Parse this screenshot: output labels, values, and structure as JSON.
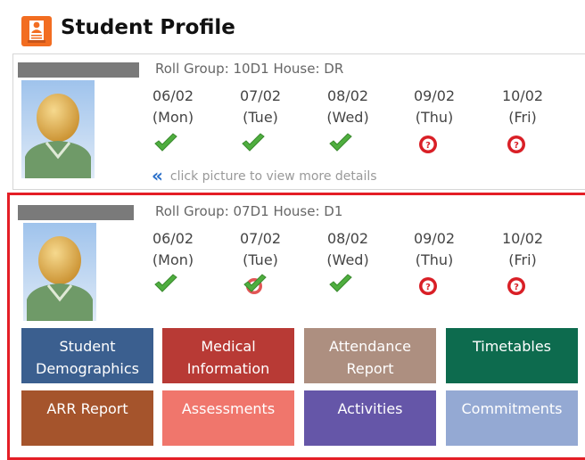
{
  "page": {
    "title": "Student Profile"
  },
  "students": [
    {
      "roll_label": "Roll Group: 10D1  House: DR",
      "days": [
        {
          "date": "06/02",
          "weekday": "(Mon)",
          "status": "present"
        },
        {
          "date": "07/02",
          "weekday": "(Tue)",
          "status": "present"
        },
        {
          "date": "08/02",
          "weekday": "(Wed)",
          "status": "present"
        },
        {
          "date": "09/02",
          "weekday": "(Thu)",
          "status": "unknown"
        },
        {
          "date": "10/02",
          "weekday": "(Fri)",
          "status": "unknown"
        }
      ],
      "hint": "click picture to view more details"
    },
    {
      "roll_label": "Roll Group: 07D1  House: D1",
      "days": [
        {
          "date": "06/02",
          "weekday": "(Mon)",
          "status": "present"
        },
        {
          "date": "07/02",
          "weekday": "(Tue)",
          "status": "present-partial"
        },
        {
          "date": "08/02",
          "weekday": "(Wed)",
          "status": "present"
        },
        {
          "date": "09/02",
          "weekday": "(Thu)",
          "status": "unknown"
        },
        {
          "date": "10/02",
          "weekday": "(Fri)",
          "status": "unknown"
        }
      ]
    }
  ],
  "tiles": [
    {
      "line1": "Student",
      "line2": "Demographics",
      "color": "#3b5f8f"
    },
    {
      "line1": "Medical",
      "line2": "Information",
      "color": "#b83a35"
    },
    {
      "line1": "Attendance",
      "line2": "Report",
      "color": "#ad8f80"
    },
    {
      "line1": "Timetables",
      "line2": "",
      "color": "#0d6b4e"
    },
    {
      "line1": "ARR Report",
      "line2": "",
      "color": "#a5542c"
    },
    {
      "line1": "Assessments",
      "line2": "",
      "color": "#f0766c"
    },
    {
      "line1": "Activities",
      "line2": "",
      "color": "#6556a8"
    },
    {
      "line1": "Commitments",
      "line2": "",
      "color": "#94a9d3"
    }
  ],
  "icons": {
    "app": "student-profile-icon",
    "present": "green-check-icon",
    "present_partial": "check-with-red-mark-icon",
    "unknown": "red-question-icon",
    "expand": "double-chevron-left-icon"
  },
  "colors": {
    "selected_border": "#e41e26",
    "present": "#4fae3f",
    "unknown": "#d91f26",
    "link": "#2a6fc9"
  }
}
